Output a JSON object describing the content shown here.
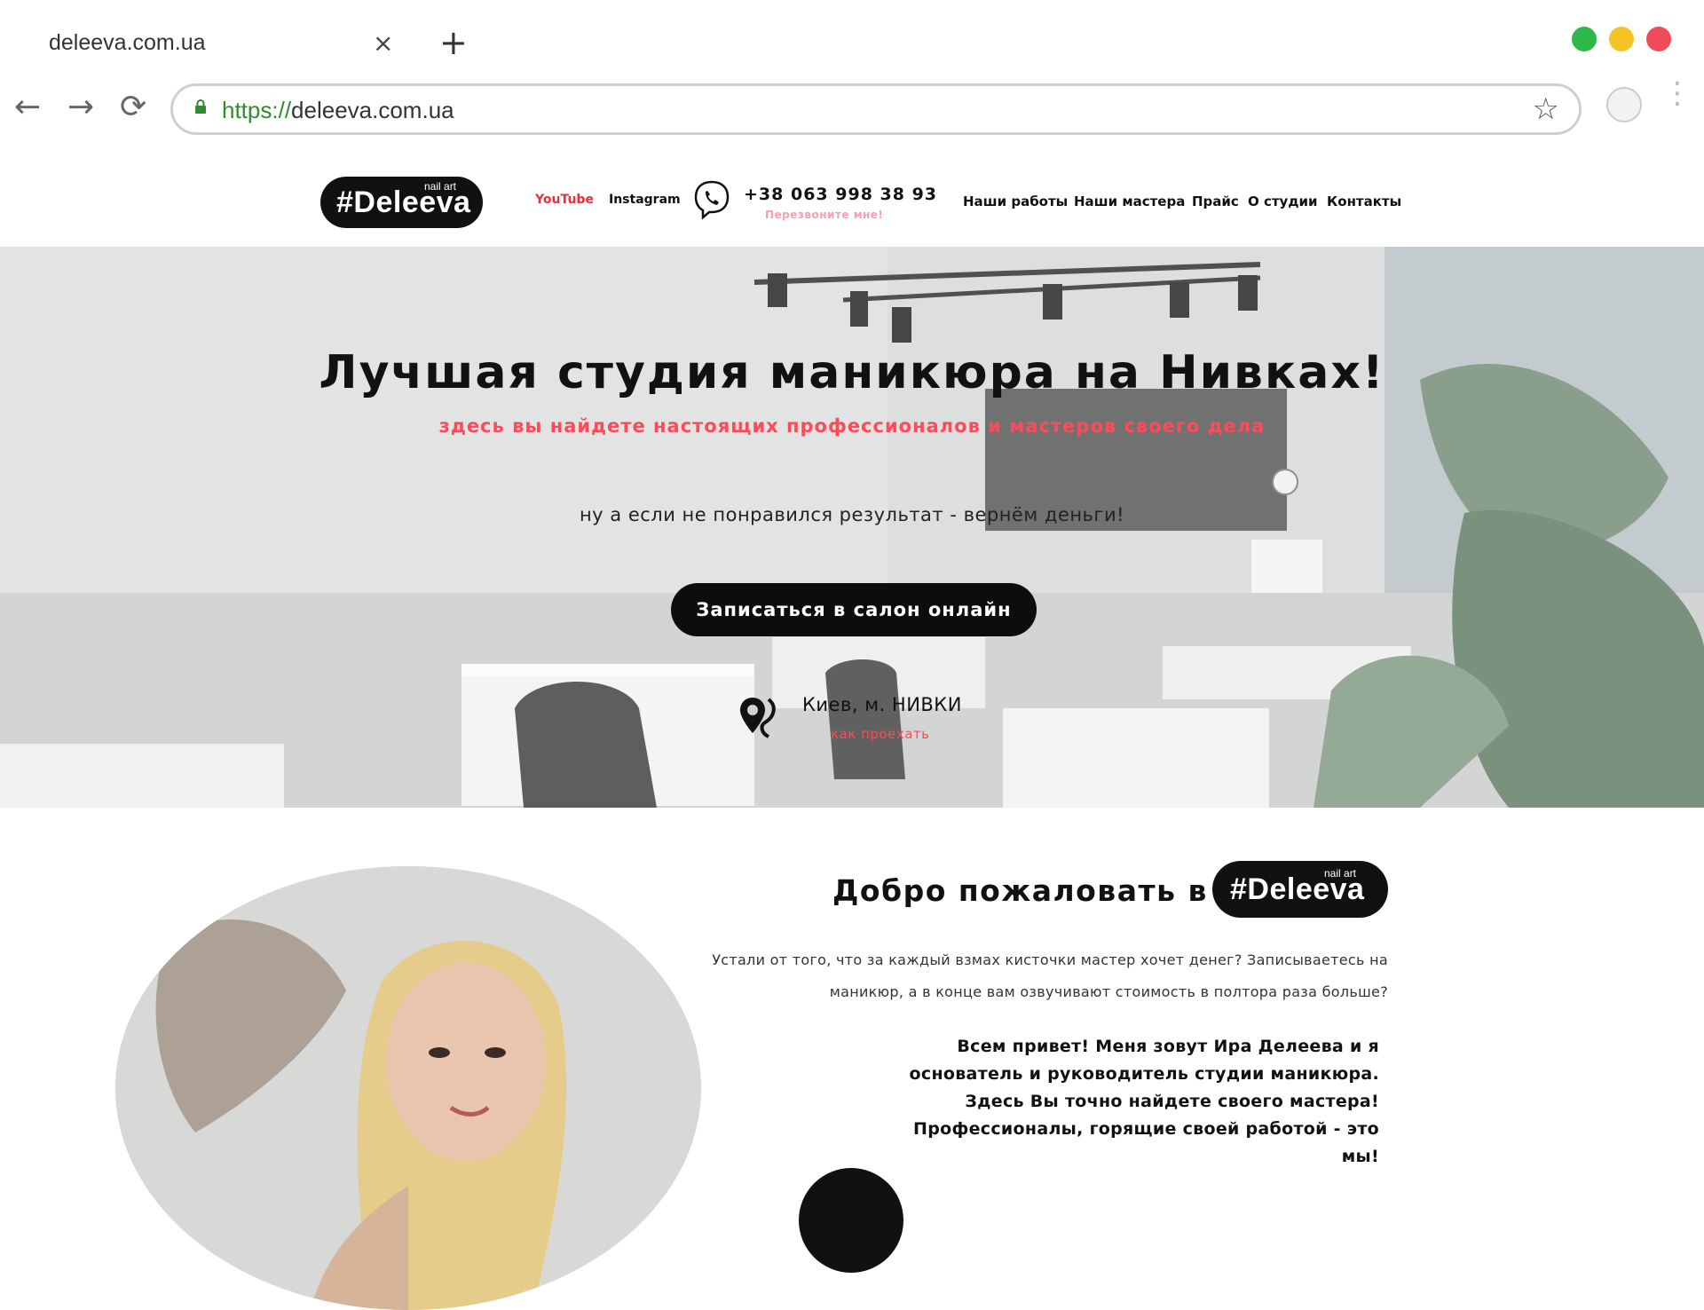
{
  "browser": {
    "tab_title": "deleeva.com.ua",
    "close_glyph": "×",
    "new_tab_glyph": "+",
    "url_scheme": "https://",
    "url_host": "deleeva.com.ua",
    "back_glyph": "←",
    "forward_glyph": "→",
    "reload_glyph": "⟳",
    "star_glyph": "☆",
    "window_dots": [
      "#2db84a",
      "#f6c324",
      "#f04c57"
    ]
  },
  "header": {
    "logo_main": "#Deleeva",
    "logo_sub": "nail art",
    "youtube": "YouTube",
    "instagram": "Instagram",
    "phone": "+38 063 998 38 93",
    "callback": "Перезвоните мне!",
    "nav": [
      "Наши работы",
      "Наши мастера",
      "Прайс",
      "О студии",
      "Контакты"
    ]
  },
  "hero": {
    "title": "Лучшая студия маникюра на Нивках!",
    "subtitle": "здесь вы найдете настоящих профессионалов и мастеров своего дела",
    "note": "ну а если не понравился результат - вернём деньги!",
    "cta": "Записаться в салон онлайн",
    "location": "Киев, м. НИВКИ",
    "directions": "как проехать"
  },
  "about": {
    "welcome": "Добро пожаловать в",
    "logo_main": "#Deleeva",
    "logo_sub": "nail art",
    "intro_line1": "Устали от того, что за каждый взмах кисточки мастер хочет денег? Записываетесь на",
    "intro_line2": "маникюр, а в конце вам озвучивают стоимость в полтора раза больше?",
    "greet_line1": "Всем привет! Меня зовут Ира Делеева и я",
    "greet_line2": "основатель и руководитель студии маникюра.",
    "greet_line3": "Здесь Вы точно найдете своего мастера!",
    "greet_line4": "Профессионалы, горящие своей работой - это",
    "greet_line5": "мы!"
  },
  "colors": {
    "accent_red": "#ff4a5a",
    "accent_pink": "#f4a0b0",
    "dark": "#111111"
  }
}
